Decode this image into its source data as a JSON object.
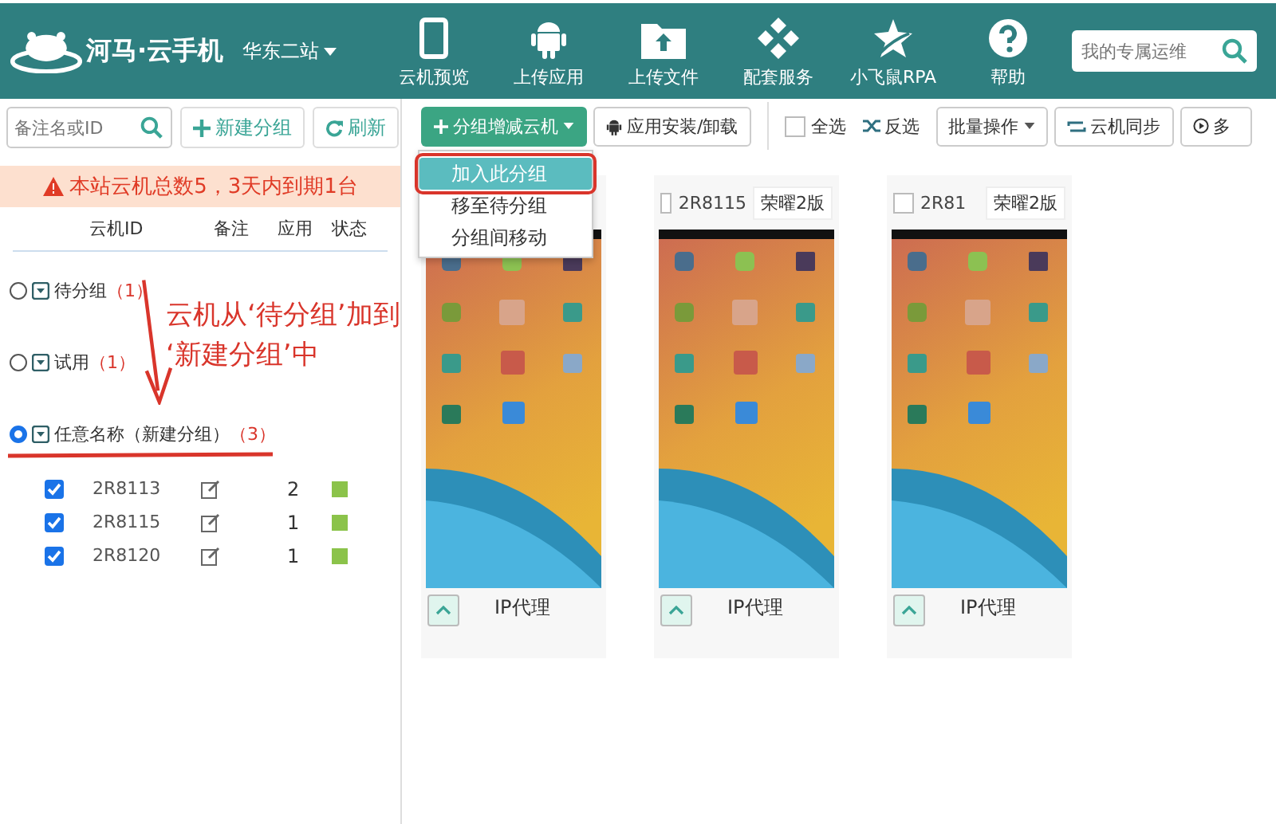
{
  "header": {
    "logo": "河马·云手机",
    "region": "华东二站",
    "nav": [
      {
        "label": "云机预览"
      },
      {
        "label": "上传应用"
      },
      {
        "label": "上传文件"
      },
      {
        "label": "配套服务"
      },
      {
        "label": "小飞鼠RPA"
      },
      {
        "label": "帮助"
      }
    ],
    "search": {
      "placeholder": "我的专属运维"
    }
  },
  "sidebar": {
    "search": {
      "placeholder": "备注名或ID"
    },
    "buttons": [
      {
        "label": "新建分组"
      },
      {
        "label": "刷新"
      }
    ],
    "notice": "本站云机总数5，3天内到期1台",
    "columns": [
      "云机ID",
      "备注",
      "应用",
      "状态"
    ],
    "groups": [
      {
        "name": "待分组",
        "count": "（1）",
        "selected": false
      },
      {
        "name": "试用",
        "count": "（1）",
        "selected": false
      },
      {
        "name": "任意名称（新建分组）",
        "count": "（3）",
        "selected": true,
        "children": [
          {
            "id": "2R8113",
            "apps": "2",
            "checked": true,
            "color": "#8bc34a"
          },
          {
            "id": "2R8115",
            "apps": "1",
            "checked": true,
            "color": "#8bc34a"
          },
          {
            "id": "2R8120",
            "apps": "1",
            "checked": true,
            "color": "#8bc34a"
          }
        ]
      }
    ]
  },
  "annotation": {
    "lines": [
      "云机从‘待分组’加到",
      "‘新建分组’中"
    ]
  },
  "toolbar": {
    "group_button": "分组增减云机",
    "install_button": "应用安装/卸载",
    "select_all": {
      "label": "全选",
      "checked": false
    },
    "invert": "反选",
    "batch": "批量操作",
    "sync": "云机同步",
    "more": "多"
  },
  "menu": {
    "items": [
      {
        "label": "加入此分组",
        "selected": true
      },
      {
        "label": "移至待分组",
        "selected": false
      },
      {
        "label": "分组间移动",
        "selected": false
      }
    ]
  },
  "cards": [
    {
      "footer": "IP代理"
    },
    {
      "id": "2R8115",
      "tag": "荣曜2版",
      "checked": false,
      "footer": "IP代理"
    },
    {
      "id": "2R81",
      "tag": "荣曜2版",
      "checked": false,
      "footer": "IP代理"
    }
  ]
}
